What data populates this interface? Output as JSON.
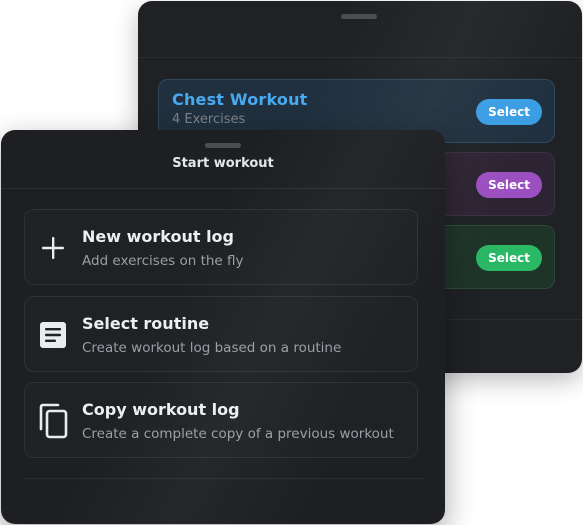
{
  "back_sheet": {
    "routines": [
      {
        "title": "Chest Workout",
        "subtitle": "4 Exercises",
        "select_label": "Select",
        "accent": "#3a9de3"
      },
      {
        "title": "",
        "subtitle": "",
        "select_label": "Select",
        "accent": "#9b4fc0"
      },
      {
        "title": "",
        "subtitle": "",
        "select_label": "Select",
        "accent": "#2bb865"
      }
    ]
  },
  "front_sheet": {
    "title": "Start workout",
    "options": [
      {
        "icon": "plus-icon",
        "title": "New workout log",
        "subtitle": "Add exercises on the fly"
      },
      {
        "icon": "document-icon",
        "title": "Select routine",
        "subtitle": "Create workout log based on a routine"
      },
      {
        "icon": "copy-icon",
        "title": "Copy workout log",
        "subtitle": "Create a complete copy of a previous workout"
      }
    ]
  },
  "colors": {
    "sheet_background": "#1d1f22",
    "text_primary": "#eceef0",
    "text_secondary": "#9a9fa5",
    "blue": "#3a9de3",
    "purple": "#9b4fc0",
    "green": "#2bb865"
  }
}
